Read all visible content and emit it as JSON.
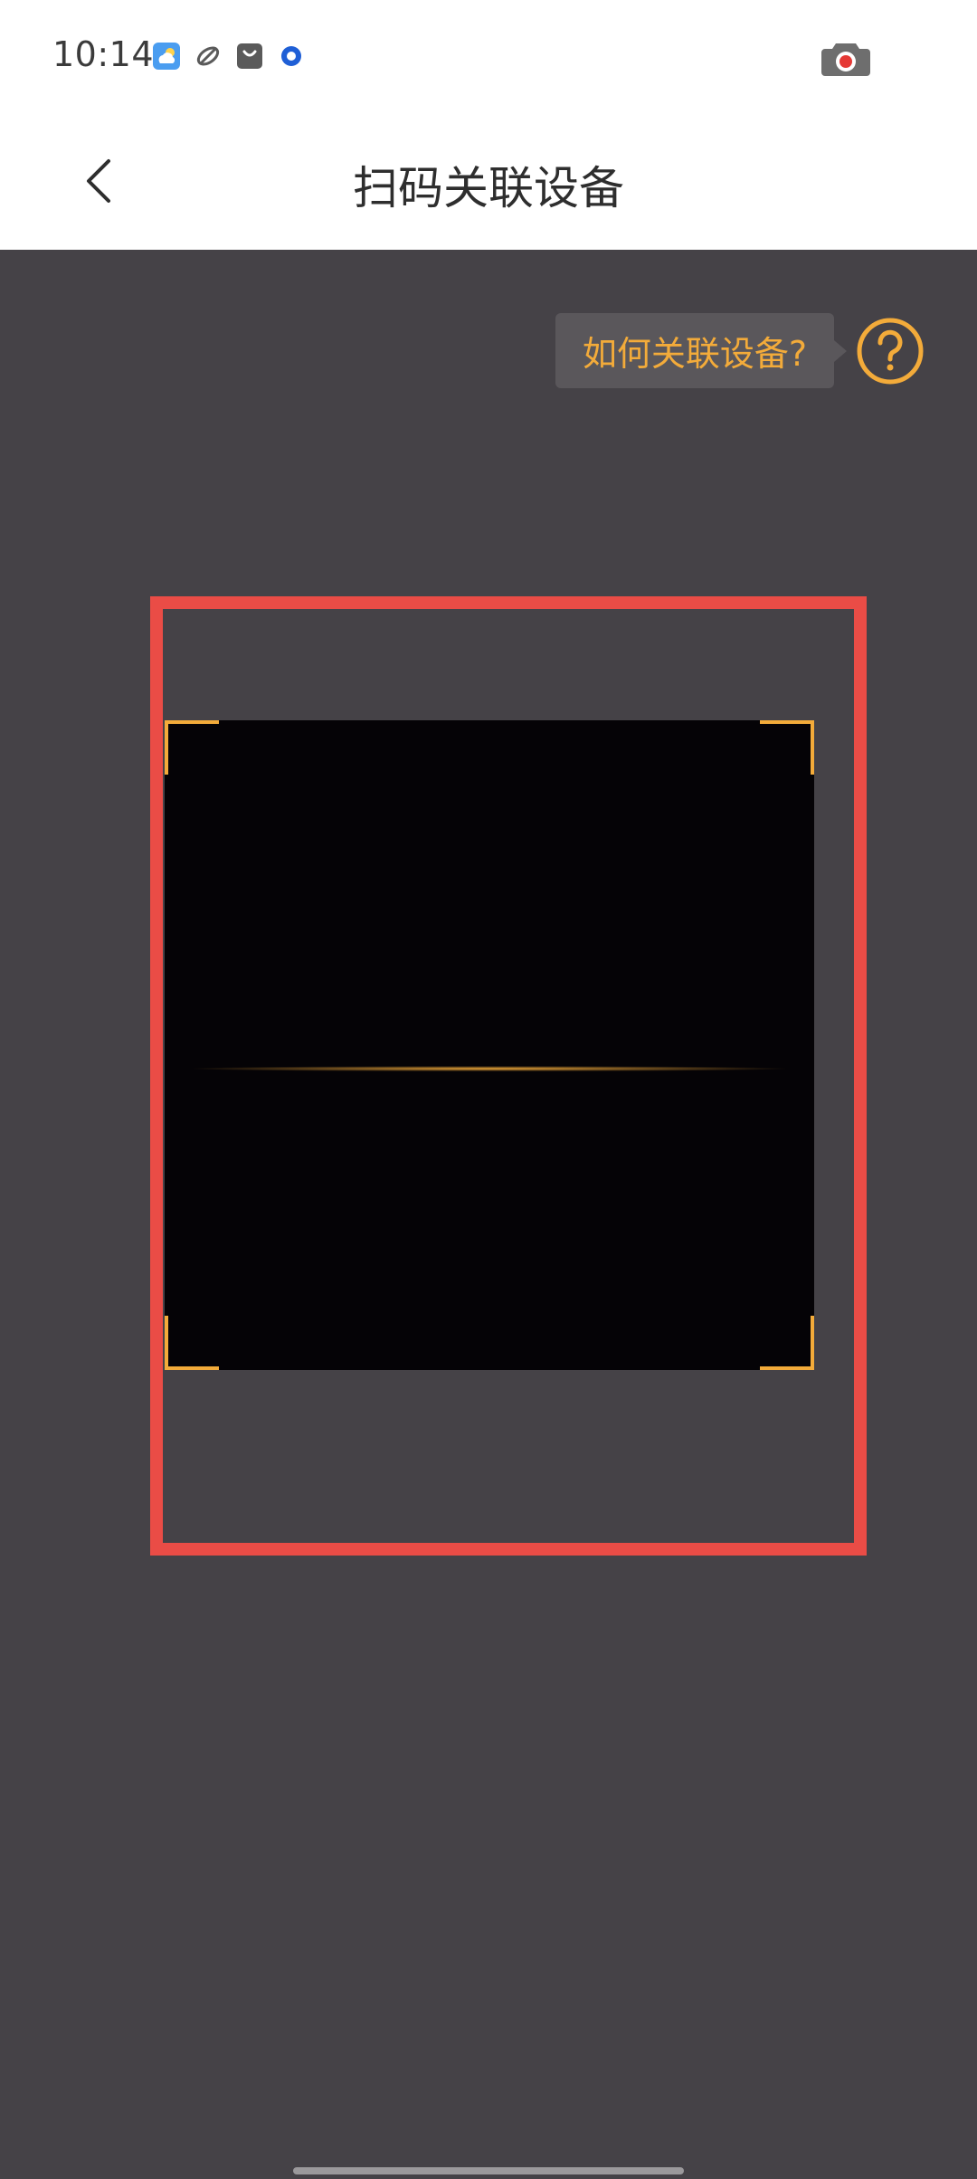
{
  "status_bar": {
    "time": "10:14",
    "notification_icons": [
      "weather-icon",
      "sync-icon",
      "shopping-bag-icon",
      "browser-icon"
    ],
    "right_icon": "screen-record-icon"
  },
  "header": {
    "back_icon": "chevron-left-icon",
    "title": "扫码关联设备"
  },
  "scanner": {
    "help_text": "如何关联设备?",
    "help_icon": "question-circle-icon"
  },
  "colors": {
    "accent": "#f3ab3a",
    "highlight_frame": "#ea4c46",
    "scanner_background": "#454247",
    "viewfinder": "#050306"
  }
}
